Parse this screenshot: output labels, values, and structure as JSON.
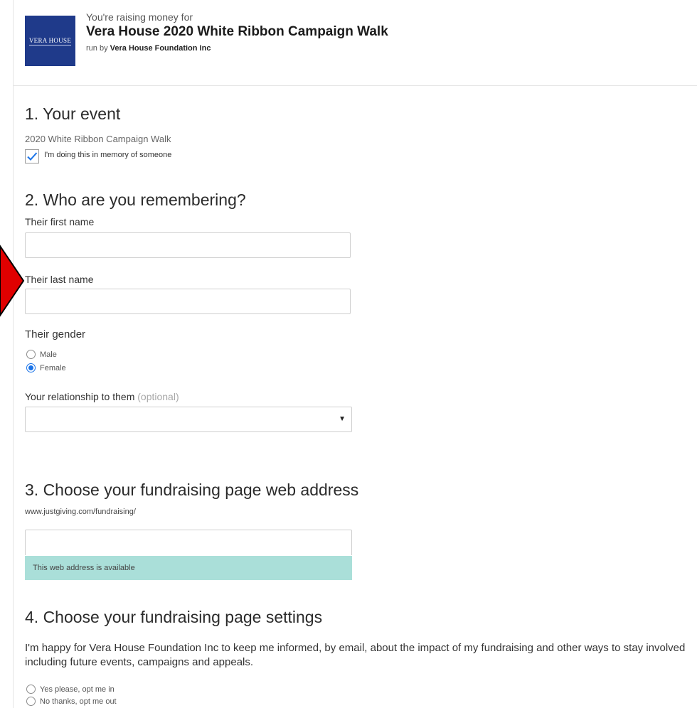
{
  "header": {
    "raising_for": "You're raising money for",
    "campaign_name": "Vera House 2020 White Ribbon Campaign Walk",
    "run_by_prefix": "run by ",
    "run_by_org": "Vera House Foundation Inc",
    "logo_text": "VERA HOUSE"
  },
  "section1": {
    "title": "1. Your event",
    "event_name": "2020 White Ribbon Campaign Walk",
    "memory_checkbox_label": "I'm doing this in memory of someone",
    "memory_checked": true
  },
  "section2": {
    "title": "2. Who are you remembering?",
    "first_name_label": "Their first name",
    "first_name_value": "",
    "last_name_label": "Their last name",
    "last_name_value": "",
    "gender_label": "Their gender",
    "gender_options": [
      "Male",
      "Female"
    ],
    "gender_selected": "Female",
    "relationship_label": "Your relationship to them",
    "relationship_optional": "(optional)",
    "relationship_value": ""
  },
  "section3": {
    "title": "3. Choose your fundraising page web address",
    "url_prefix": "www.justgiving.com/fundraising/",
    "url_value": "",
    "availability_message": "This web address is available"
  },
  "section4": {
    "title": "4. Choose your fundraising page settings",
    "optin_text": "I'm happy for Vera House Foundation Inc to keep me informed, by email, about the impact of my fundraising and other ways to stay involved including future events, campaigns and appeals.",
    "optin_options": [
      "Yes please, opt me in",
      "No thanks, opt me out"
    ]
  },
  "colors": {
    "logo_bg": "#1f3a8a",
    "check_accent": "#1a73e8",
    "available_bg": "#aadfd9",
    "pointer_arrow": "#e00000"
  }
}
